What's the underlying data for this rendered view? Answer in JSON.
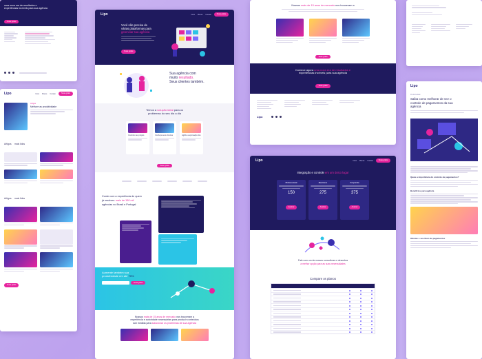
{
  "brand": {
    "logo": "Lipo",
    "primary": "#1f1a5e",
    "accent": "#e6249e",
    "cyan": "#2bc4e6"
  },
  "nav": {
    "items": [
      "Início",
      "Planos",
      "Contato",
      "Quem somos"
    ],
    "cta": "Teste grátis"
  },
  "card_a": {
    "heading": "uma nova era de resultados e",
    "heading2": "experiências incríveis para sua agência",
    "cta": "Teste grátis"
  },
  "card_b": {
    "hero_h1": "Você não precisa de",
    "hero_h2": "várias plataformas para",
    "hero_h3": "gerenciar sua agência",
    "hero_cta": "Teste grátis",
    "results_h1": "Sua agência com",
    "results_h2": "muito",
    "results_h2b": "resultado.",
    "results_h3": "Seus clientes também.",
    "solution_h1": "Temos a",
    "solution_h1b": "solução ideal",
    "solution_h1c": "para os",
    "solution_h2": "problemas do seu dia a dia",
    "features": [
      "Controle seu projeto",
      "Conheça seus clientes",
      "Agilize a aprovação dos"
    ],
    "experience_h": "Conte com a experiência de quem já resolveu",
    "experience_mag": "mais de 150 mil",
    "experience_h2": "agências no Brasil e Portugal",
    "save_h1": "Aumente também sua",
    "save_h2": "produtividade em até",
    "save_pct": "70%",
    "market_h1": "Nossos",
    "market_mag": "mais de 15 anos de mercado",
    "market_h2": "nos trouxeram a",
    "market_h3": "experiência e autoridade necessárias para produzir conteúdos",
    "market_h4": "sob medida para",
    "market_mag2": "solucionar os problemas de sua agência"
  },
  "card_c": {
    "headline1": "Nossos",
    "headline_mag": "mais de 15 anos de mercado",
    "headline2": "nos trouxeram a",
    "era1": "Comece agora",
    "era_mag": "uma nova era de resultados e",
    "era2": "experiências incríveis",
    "era3": "para sua agência",
    "cta": "Teste grátis"
  },
  "card_e": {
    "tag": "Artigos",
    "title": "Melhore as produtividade",
    "title2": "Quais são as principais",
    "section": "Artigos",
    "section_mag": "mais lidos"
  },
  "card_f": {
    "heading1": "Integração e controle",
    "heading_mag": "em um único lugar",
    "plans": [
      {
        "name": "Professional",
        "price": "150"
      },
      {
        "name": "Business",
        "price": "275"
      },
      {
        "name": "Corporate",
        "price": "375"
      }
    ],
    "plans_cta": "Assinar",
    "fit1": "Fale com um de nossos consultores e descubra",
    "fit_mag": "a melhor opção para as suas necessidades",
    "compare": "Compare os planos"
  },
  "card_g": {
    "category": "Produtividade",
    "title1": "Saiba como melhorar de vez o",
    "title2": "controle de pagamentos da sua",
    "title3": "agência",
    "sub1": "Quais a importância do controle de pagamentos?",
    "sub2": "Benefícios para agência",
    "sub3": "Otimize o seu fluxo de pagamentos"
  }
}
